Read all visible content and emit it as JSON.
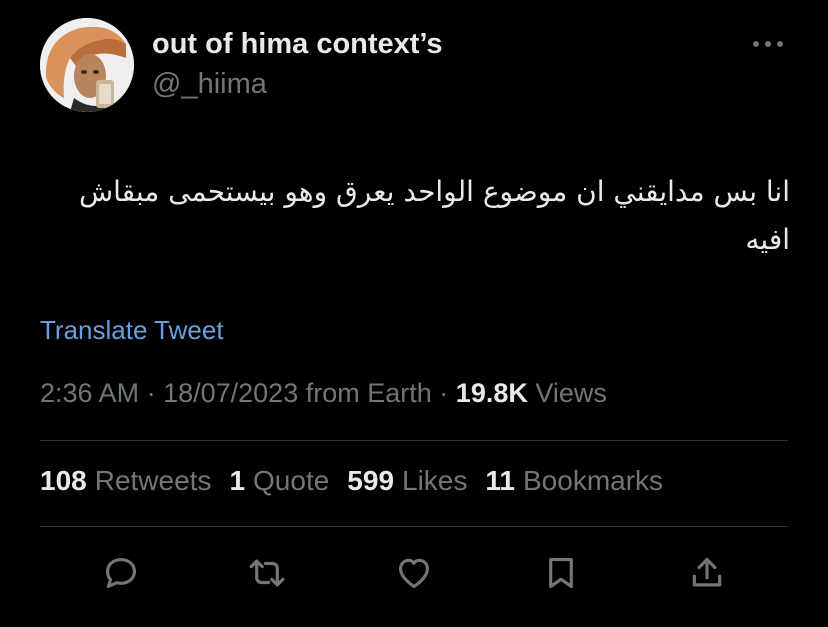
{
  "user": {
    "display_name": "out of hima context’s",
    "handle": "@_hiima"
  },
  "tweet": {
    "text": "انا بس مدايقني ان موضوع الواحد يعرق وهو بيستحمى مبقاش افيه",
    "translate_label": "Translate Tweet"
  },
  "meta": {
    "time": "2:36 AM",
    "date": "18/07/2023",
    "source": "from Earth",
    "views_count": "19.8K",
    "views_label": "Views"
  },
  "stats": {
    "retweets_count": "108",
    "retweets_label": "Retweets",
    "quotes_count": "1",
    "quotes_label": "Quote",
    "likes_count": "599",
    "likes_label": "Likes",
    "bookmarks_count": "11",
    "bookmarks_label": "Bookmarks"
  },
  "icons": {
    "more": "more-horizontal-icon",
    "reply": "reply-icon",
    "retweet": "retweet-icon",
    "like": "heart-icon",
    "bookmark": "bookmark-icon",
    "share": "share-icon"
  },
  "colors": {
    "background": "#000000",
    "text": "#e7e9ea",
    "secondary": "#71767b",
    "link": "#6a9fe0",
    "divider": "#2f3336"
  }
}
